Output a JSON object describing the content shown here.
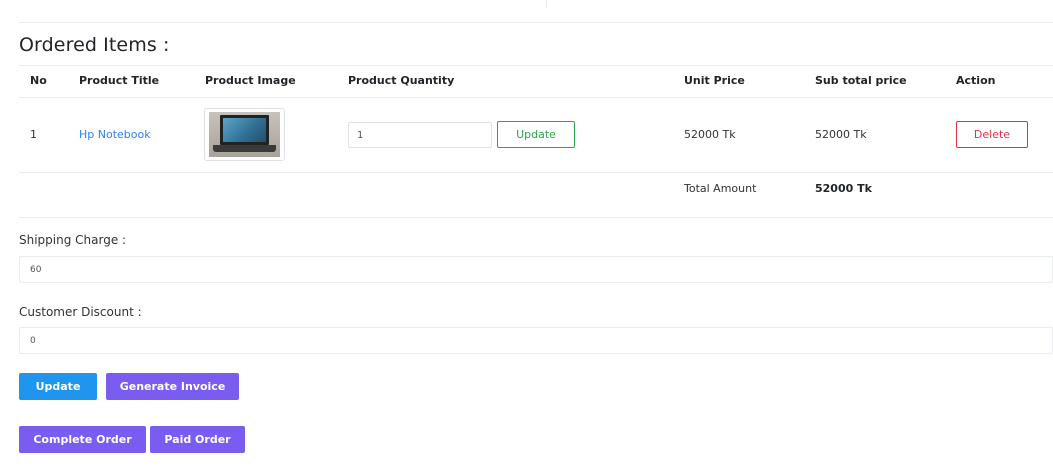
{
  "section": {
    "title": "Ordered Items :"
  },
  "table": {
    "headers": {
      "no": "No",
      "title": "Product Title",
      "image": "Product Image",
      "quantity": "Product Quantity",
      "unit_price": "Unit Price",
      "subtotal": "Sub total price",
      "action": "Action"
    },
    "rows": [
      {
        "no": "1",
        "title": "Hp Notebook",
        "quantity": "1",
        "update_label": "Update",
        "unit_price": "52000 Tk",
        "subtotal": "52000 Tk",
        "delete_label": "Delete"
      }
    ],
    "total": {
      "label": "Total Amount",
      "value": "52000 Tk"
    }
  },
  "shipping": {
    "label": "Shipping Charge :",
    "value": "60"
  },
  "discount": {
    "label": "Customer Discount :",
    "value": "0"
  },
  "actions": {
    "update": "Update",
    "generate_invoice": "Generate Invoice",
    "complete_order": "Complete Order",
    "paid_order": "Paid Order"
  },
  "colors": {
    "primary": "#1e96f0",
    "purple": "#7b5cf0",
    "success": "#28a745",
    "danger": "#dc3545",
    "link": "#2f80ed"
  },
  "icons": {
    "product_image": "laptop-image"
  }
}
